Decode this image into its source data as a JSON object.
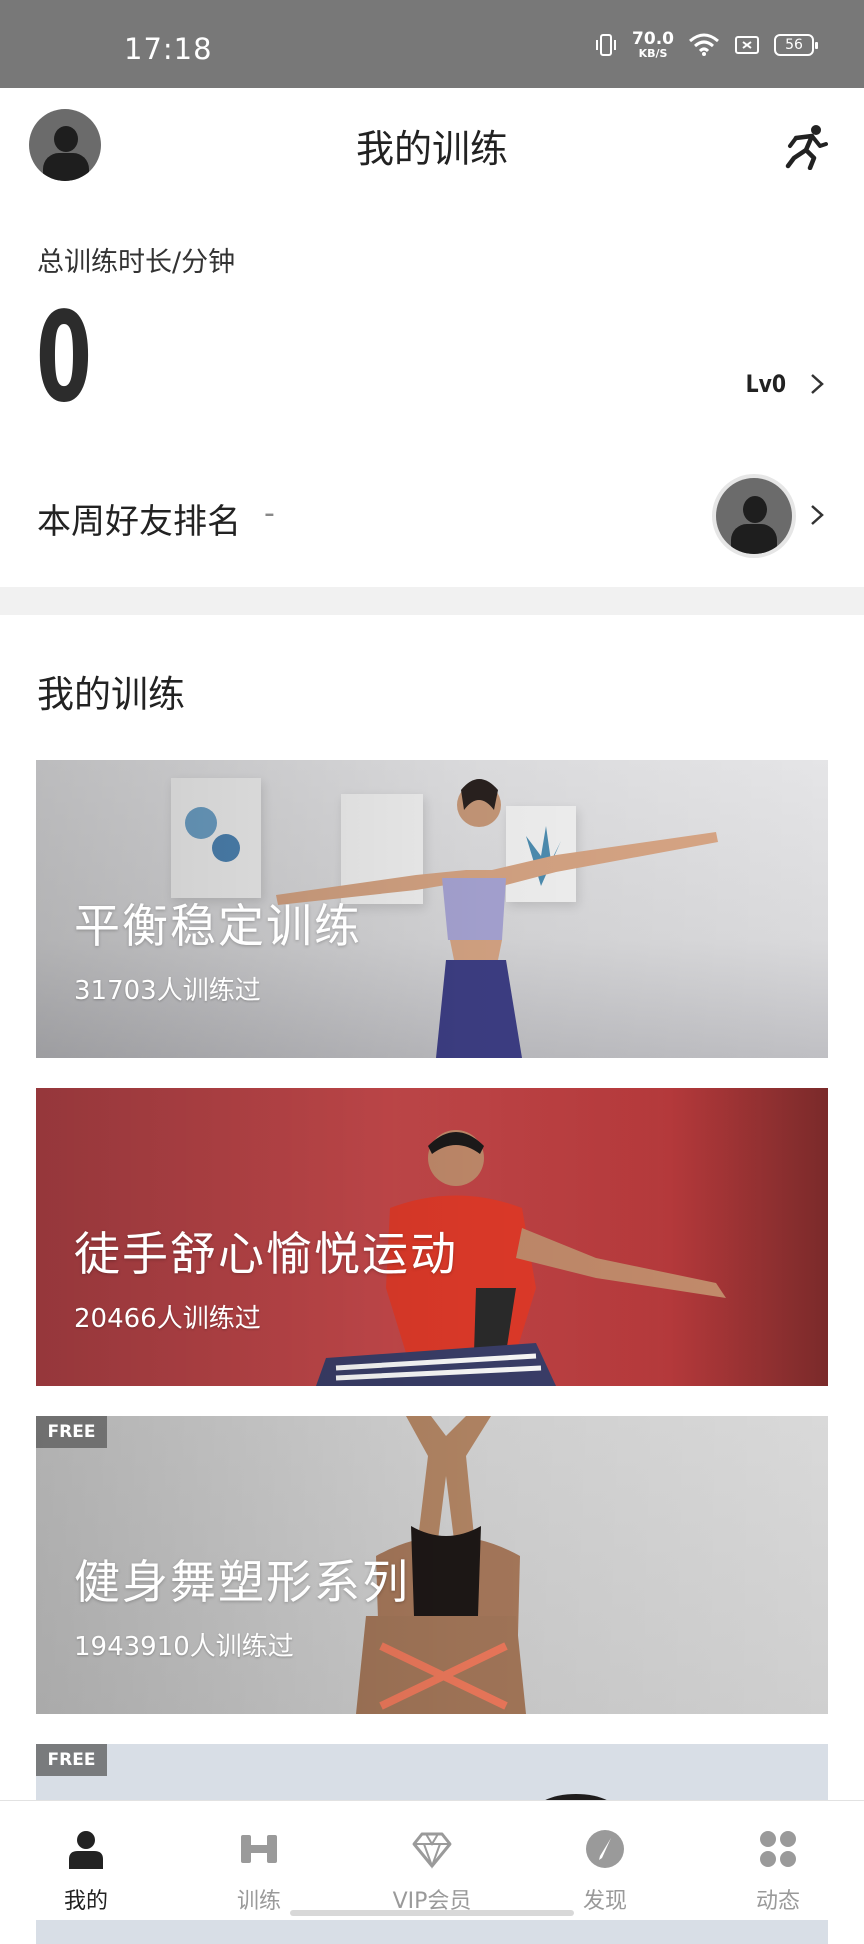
{
  "status_bar": {
    "time": "17:18",
    "net_speed_value": "70.0",
    "net_speed_unit": "KB/S",
    "battery": "56",
    "icons": [
      "vibrate-icon",
      "wifi-icon",
      "sim-icon",
      "battery-icon"
    ]
  },
  "header": {
    "title": "我的训练",
    "icons": [
      "avatar",
      "runner-icon"
    ]
  },
  "stats": {
    "total_label": "总训练时长/分钟",
    "total_value": "0",
    "level": "Lv0"
  },
  "ranking": {
    "label": "本周好友排名",
    "value": "-"
  },
  "section": {
    "title": "我的训练"
  },
  "courses": [
    {
      "title": "平衡稳定训练",
      "subtitle": "31703人训练过",
      "badge": ""
    },
    {
      "title": "徒手舒心愉悦运动",
      "subtitle": "20466人训练过",
      "badge": ""
    },
    {
      "title": "健身舞塑形系列",
      "subtitle": "1943910人训练过",
      "badge": "FREE"
    },
    {
      "title": "",
      "subtitle": "",
      "badge": "FREE"
    }
  ],
  "bottom_nav": [
    {
      "label": "我的",
      "icon": "person-icon",
      "active": true
    },
    {
      "label": "训练",
      "icon": "dumbbell-icon",
      "active": false
    },
    {
      "label": "VIP会员",
      "icon": "diamond-icon",
      "active": false
    },
    {
      "label": "发现",
      "icon": "compass-icon",
      "active": false
    },
    {
      "label": "动态",
      "icon": "grid-dots-icon",
      "active": false
    }
  ],
  "colors": {
    "status_bar": "#787878",
    "active_nav": "#222222",
    "inactive_nav": "#9a9a9a",
    "divider": "#f1f1f1"
  }
}
